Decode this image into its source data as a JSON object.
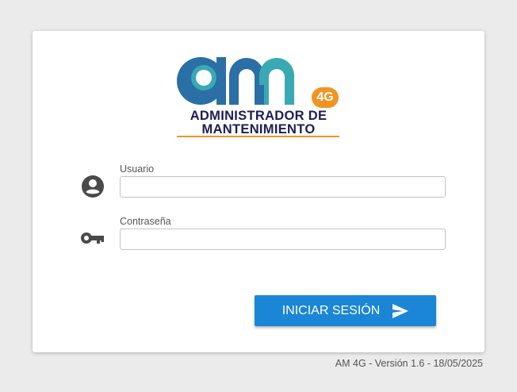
{
  "logo": {
    "badge": "4G",
    "line1": "ADMINISTRADOR DE",
    "line2": "MANTENIMIENTO"
  },
  "form": {
    "username": {
      "label": "Usuario",
      "value": "",
      "icon": "account-circle-icon"
    },
    "password": {
      "label": "Contraseña",
      "value": "",
      "icon": "key-icon"
    },
    "submit": {
      "label": "INICIAR SESIÓN",
      "icon": "send-icon"
    }
  },
  "footer": {
    "version": "AM 4G - Versión 1.6 - 18/05/2025"
  },
  "colors": {
    "background": "#ebebeb",
    "button": "#1a86d5",
    "logo_blue": "#2a6fa6",
    "logo_teal": "#3aa9b3",
    "logo_orange": "#f29422",
    "logo_text": "#1d1d55"
  }
}
